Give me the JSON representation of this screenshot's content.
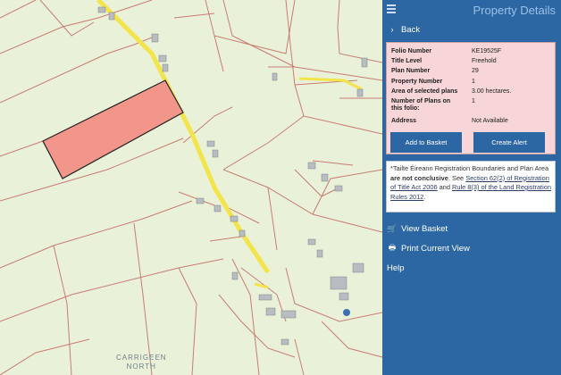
{
  "panel": {
    "title": "Property Details",
    "back_label": "Back"
  },
  "details": {
    "rows": [
      {
        "label": "Folio Number",
        "value": "KE19525F"
      },
      {
        "label": "Title Level",
        "value": "Freehold"
      },
      {
        "label": "Plan Number",
        "value": "29"
      },
      {
        "label": "Property Number",
        "value": "1"
      },
      {
        "label": "Area of selected plans",
        "value": "3.00 hectares."
      },
      {
        "label": "Number of Plans on this folio:",
        "value": "1"
      },
      {
        "label": "Address",
        "value": "Not Available"
      }
    ],
    "add_basket_label": "Add to Basket",
    "create_alert_label": "Create Alert"
  },
  "note": {
    "part1": "*Tailte Éireann Registration Boundaries and Plan Area ",
    "bold": "are not conclusive",
    "part2": ". See ",
    "link1": "Section 62(2) of Registration of Title Act 2006",
    "part3": " and ",
    "link2": "Rule 8(3) of the Land Registration Rules 2012",
    "part4": "."
  },
  "menu": {
    "view_basket": "View Basket",
    "print_view": "Print Current View",
    "help": "Help"
  },
  "map": {
    "place_label_line1": "CARRIGEEN",
    "place_label_line2": "NORTH"
  },
  "colors": {
    "panel_bg": "#2c67a3",
    "selected_plot": "#f2958a",
    "road": "#f2e44a",
    "boundary": "#c97b72"
  }
}
